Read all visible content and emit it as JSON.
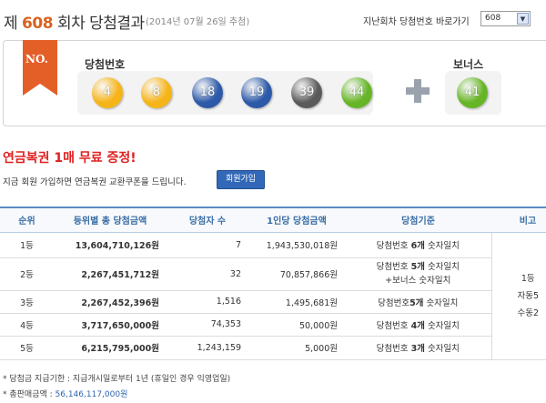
{
  "header": {
    "prefix": "제",
    "round": "608",
    "suffix": "회차 당첨결과",
    "date": "(2014년 07월 26일 추첨)",
    "past_label": "지난회차 당첨번호 바로가기",
    "round_select": "608"
  },
  "draw": {
    "ribbon": "NO.",
    "winning_label": "당첨번호",
    "bonus_label": "보너스",
    "balls": [
      {
        "n": "4",
        "color": "#f5b418"
      },
      {
        "n": "8",
        "color": "#f5b418"
      },
      {
        "n": "18",
        "color": "#2c59a8"
      },
      {
        "n": "19",
        "color": "#2c59a8"
      },
      {
        "n": "39",
        "color": "#5a5a5a"
      },
      {
        "n": "44",
        "color": "#66b526"
      }
    ],
    "bonus": {
      "n": "41",
      "color": "#66b526"
    }
  },
  "promo": {
    "title": "연금복권 1매 무료 증정!",
    "subtitle": "지금 회원 가입하면 연금복권 교환쿠폰을 드립니다.",
    "join_button": "회원가입"
  },
  "table": {
    "headers": [
      "순위",
      "등위별 총 당첨금액",
      "당첨자 수",
      "1인당 당첨금액",
      "당첨기준",
      "비고"
    ],
    "rows": [
      {
        "rank": "1등",
        "total": "13,604,710,126원",
        "winners": "7",
        "per": "1,943,530,018원",
        "crit_pre": "당첨번호 ",
        "crit_bold": "6개",
        "crit_post": " 숫자일치",
        "crit2": ""
      },
      {
        "rank": "2등",
        "total": "2,267,451,712원",
        "winners": "32",
        "per": "70,857,866원",
        "crit_pre": "당첨번호 ",
        "crit_bold": "5개",
        "crit_post": " 숫자일치",
        "crit2": "+보너스 숫자일치"
      },
      {
        "rank": "3등",
        "total": "2,267,452,396원",
        "winners": "1,516",
        "per": "1,495,681원",
        "crit_pre": "당첨번호",
        "crit_bold": "5개",
        "crit_post": " 숫자일치",
        "crit2": ""
      },
      {
        "rank": "4등",
        "total": "3,717,650,000원",
        "winners": "74,353",
        "per": "50,000원",
        "crit_pre": "당첨번호 ",
        "crit_bold": "4개",
        "crit_post": " 숫자일치",
        "crit2": ""
      },
      {
        "rank": "5등",
        "total": "6,215,795,000원",
        "winners": "1,243,159",
        "per": "5,000원",
        "crit_pre": "당첨번호 ",
        "crit_bold": "3개",
        "crit_post": " 숫자일치",
        "crit2": ""
      }
    ],
    "note": [
      "1등",
      "자동5",
      "수동2"
    ]
  },
  "footer": {
    "line1": "* 당첨금 지급기한 : 지급개시일로부터 1년 (휴일인 경우 익영업일)",
    "line2_label": "* 총판매금액 : ",
    "line2_amount": "56,146,117,000원"
  }
}
